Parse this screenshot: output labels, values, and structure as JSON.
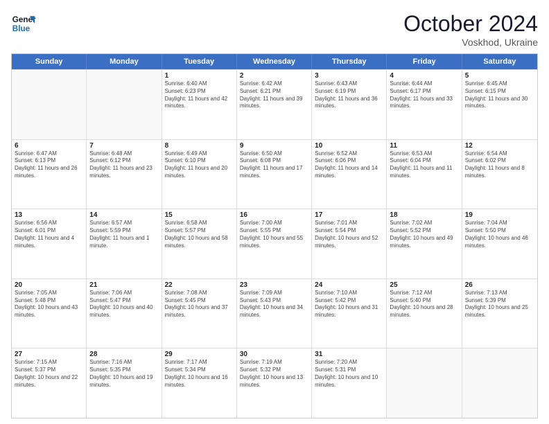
{
  "logo": {
    "line1": "General",
    "line2": "Blue"
  },
  "title": "October 2024",
  "subtitle": "Voskhod, Ukraine",
  "header_days": [
    "Sunday",
    "Monday",
    "Tuesday",
    "Wednesday",
    "Thursday",
    "Friday",
    "Saturday"
  ],
  "weeks": [
    [
      {
        "day": "",
        "sunrise": "",
        "sunset": "",
        "daylight": ""
      },
      {
        "day": "",
        "sunrise": "",
        "sunset": "",
        "daylight": ""
      },
      {
        "day": "1",
        "sunrise": "Sunrise: 6:40 AM",
        "sunset": "Sunset: 6:23 PM",
        "daylight": "Daylight: 11 hours and 42 minutes."
      },
      {
        "day": "2",
        "sunrise": "Sunrise: 6:42 AM",
        "sunset": "Sunset: 6:21 PM",
        "daylight": "Daylight: 11 hours and 39 minutes."
      },
      {
        "day": "3",
        "sunrise": "Sunrise: 6:43 AM",
        "sunset": "Sunset: 6:19 PM",
        "daylight": "Daylight: 11 hours and 36 minutes."
      },
      {
        "day": "4",
        "sunrise": "Sunrise: 6:44 AM",
        "sunset": "Sunset: 6:17 PM",
        "daylight": "Daylight: 11 hours and 33 minutes."
      },
      {
        "day": "5",
        "sunrise": "Sunrise: 6:45 AM",
        "sunset": "Sunset: 6:15 PM",
        "daylight": "Daylight: 11 hours and 30 minutes."
      }
    ],
    [
      {
        "day": "6",
        "sunrise": "Sunrise: 6:47 AM",
        "sunset": "Sunset: 6:13 PM",
        "daylight": "Daylight: 11 hours and 26 minutes."
      },
      {
        "day": "7",
        "sunrise": "Sunrise: 6:48 AM",
        "sunset": "Sunset: 6:12 PM",
        "daylight": "Daylight: 11 hours and 23 minutes."
      },
      {
        "day": "8",
        "sunrise": "Sunrise: 6:49 AM",
        "sunset": "Sunset: 6:10 PM",
        "daylight": "Daylight: 11 hours and 20 minutes."
      },
      {
        "day": "9",
        "sunrise": "Sunrise: 6:50 AM",
        "sunset": "Sunset: 6:08 PM",
        "daylight": "Daylight: 11 hours and 17 minutes."
      },
      {
        "day": "10",
        "sunrise": "Sunrise: 6:52 AM",
        "sunset": "Sunset: 6:06 PM",
        "daylight": "Daylight: 11 hours and 14 minutes."
      },
      {
        "day": "11",
        "sunrise": "Sunrise: 6:53 AM",
        "sunset": "Sunset: 6:04 PM",
        "daylight": "Daylight: 11 hours and 11 minutes."
      },
      {
        "day": "12",
        "sunrise": "Sunrise: 6:54 AM",
        "sunset": "Sunset: 6:02 PM",
        "daylight": "Daylight: 11 hours and 8 minutes."
      }
    ],
    [
      {
        "day": "13",
        "sunrise": "Sunrise: 6:56 AM",
        "sunset": "Sunset: 6:01 PM",
        "daylight": "Daylight: 11 hours and 4 minutes."
      },
      {
        "day": "14",
        "sunrise": "Sunrise: 6:57 AM",
        "sunset": "Sunset: 5:59 PM",
        "daylight": "Daylight: 11 hours and 1 minute."
      },
      {
        "day": "15",
        "sunrise": "Sunrise: 6:58 AM",
        "sunset": "Sunset: 5:57 PM",
        "daylight": "Daylight: 10 hours and 58 minutes."
      },
      {
        "day": "16",
        "sunrise": "Sunrise: 7:00 AM",
        "sunset": "Sunset: 5:55 PM",
        "daylight": "Daylight: 10 hours and 55 minutes."
      },
      {
        "day": "17",
        "sunrise": "Sunrise: 7:01 AM",
        "sunset": "Sunset: 5:54 PM",
        "daylight": "Daylight: 10 hours and 52 minutes."
      },
      {
        "day": "18",
        "sunrise": "Sunrise: 7:02 AM",
        "sunset": "Sunset: 5:52 PM",
        "daylight": "Daylight: 10 hours and 49 minutes."
      },
      {
        "day": "19",
        "sunrise": "Sunrise: 7:04 AM",
        "sunset": "Sunset: 5:50 PM",
        "daylight": "Daylight: 10 hours and 46 minutes."
      }
    ],
    [
      {
        "day": "20",
        "sunrise": "Sunrise: 7:05 AM",
        "sunset": "Sunset: 5:48 PM",
        "daylight": "Daylight: 10 hours and 43 minutes."
      },
      {
        "day": "21",
        "sunrise": "Sunrise: 7:06 AM",
        "sunset": "Sunset: 5:47 PM",
        "daylight": "Daylight: 10 hours and 40 minutes."
      },
      {
        "day": "22",
        "sunrise": "Sunrise: 7:08 AM",
        "sunset": "Sunset: 5:45 PM",
        "daylight": "Daylight: 10 hours and 37 minutes."
      },
      {
        "day": "23",
        "sunrise": "Sunrise: 7:09 AM",
        "sunset": "Sunset: 5:43 PM",
        "daylight": "Daylight: 10 hours and 34 minutes."
      },
      {
        "day": "24",
        "sunrise": "Sunrise: 7:10 AM",
        "sunset": "Sunset: 5:42 PM",
        "daylight": "Daylight: 10 hours and 31 minutes."
      },
      {
        "day": "25",
        "sunrise": "Sunrise: 7:12 AM",
        "sunset": "Sunset: 5:40 PM",
        "daylight": "Daylight: 10 hours and 28 minutes."
      },
      {
        "day": "26",
        "sunrise": "Sunrise: 7:13 AM",
        "sunset": "Sunset: 5:39 PM",
        "daylight": "Daylight: 10 hours and 25 minutes."
      }
    ],
    [
      {
        "day": "27",
        "sunrise": "Sunrise: 7:15 AM",
        "sunset": "Sunset: 5:37 PM",
        "daylight": "Daylight: 10 hours and 22 minutes."
      },
      {
        "day": "28",
        "sunrise": "Sunrise: 7:16 AM",
        "sunset": "Sunset: 5:35 PM",
        "daylight": "Daylight: 10 hours and 19 minutes."
      },
      {
        "day": "29",
        "sunrise": "Sunrise: 7:17 AM",
        "sunset": "Sunset: 5:34 PM",
        "daylight": "Daylight: 10 hours and 16 minutes."
      },
      {
        "day": "30",
        "sunrise": "Sunrise: 7:19 AM",
        "sunset": "Sunset: 5:32 PM",
        "daylight": "Daylight: 10 hours and 13 minutes."
      },
      {
        "day": "31",
        "sunrise": "Sunrise: 7:20 AM",
        "sunset": "Sunset: 5:31 PM",
        "daylight": "Daylight: 10 hours and 10 minutes."
      },
      {
        "day": "",
        "sunrise": "",
        "sunset": "",
        "daylight": ""
      },
      {
        "day": "",
        "sunrise": "",
        "sunset": "",
        "daylight": ""
      }
    ]
  ]
}
